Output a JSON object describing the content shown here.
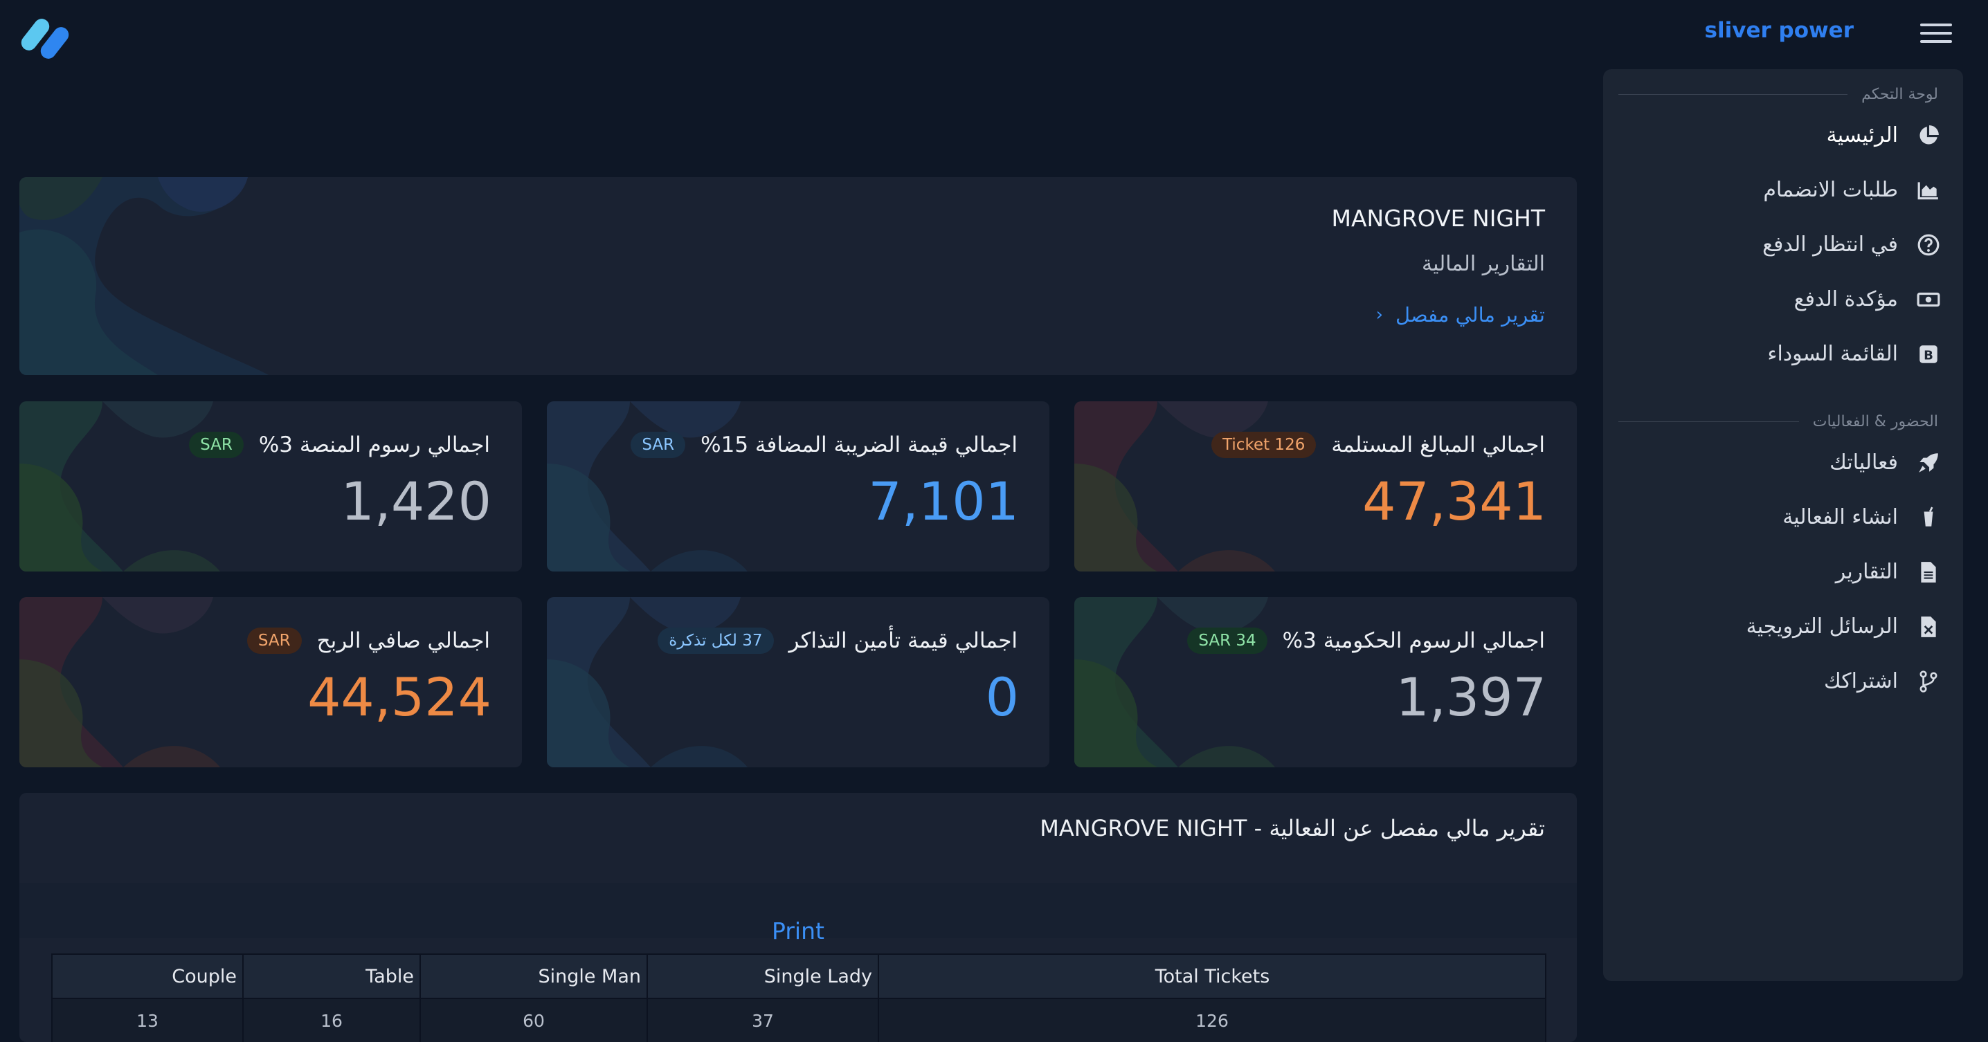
{
  "header": {
    "brand": "sliver power",
    "logo_icon": "logo-icon",
    "menu_icon": "hamburger-icon"
  },
  "sidebar": {
    "section1_title": "لوحة التحكم",
    "section2_title": "الحضور & الفعاليات",
    "items": [
      {
        "label": "الرئيسية",
        "icon": "pie-chart-icon"
      },
      {
        "label": "طلبات الانضمام",
        "icon": "area-chart-icon"
      },
      {
        "label": "في انتظار الدفع",
        "icon": "question-circle-icon"
      },
      {
        "label": "مؤكدة الدفع",
        "icon": "money-bill-icon"
      },
      {
        "label": "القائمة السوداء",
        "icon": "bold-b-icon"
      },
      {
        "label": "فعالياتك",
        "icon": "rocket-icon"
      },
      {
        "label": "انشاء الفعالية",
        "icon": "drink-icon"
      },
      {
        "label": "التقارير",
        "icon": "document-icon"
      },
      {
        "label": "الرسائل الترويجية",
        "icon": "file-x-icon"
      },
      {
        "label": "اشتراكك",
        "icon": "code-branch-icon"
      }
    ]
  },
  "hero": {
    "title": "MANGROVE NIGHT",
    "subtitle": "التقارير المالية",
    "link": "تقرير مالي مفصل"
  },
  "stats": [
    {
      "label": "اجمالي المبالغ المستلمة",
      "badge": "Ticket 126",
      "value": "47,341"
    },
    {
      "label": "اجمالي قيمة الضريبة المضافة 15%",
      "badge": "SAR",
      "value": "7,101"
    },
    {
      "label": "اجمالي رسوم المنصة 3%",
      "badge": "SAR",
      "value": "1,420"
    },
    {
      "label": "اجمالي الرسوم الحكومية 3%",
      "badge": "SAR 34",
      "value": "1,397"
    },
    {
      "label": "اجمالي قيمة تأمين التذاكر",
      "badge": "37 لكل تذكرة",
      "value": "0"
    },
    {
      "label": "اجمالي صافي الربح",
      "badge": "SAR",
      "value": "44,524"
    }
  ],
  "report": {
    "title": "تقرير مالي مفصل عن الفعالية - MANGROVE NIGHT",
    "print": "Print",
    "headers": [
      "Couple",
      "Table",
      "Single Man",
      "Single Lady",
      "Total Tickets"
    ],
    "row": [
      "13",
      "16",
      "60",
      "37",
      "126"
    ]
  },
  "colors": {
    "background": "#0e1726",
    "card": "#1a2232",
    "accent_blue": "#3b8ff5",
    "orange": "#ee8a45"
  }
}
